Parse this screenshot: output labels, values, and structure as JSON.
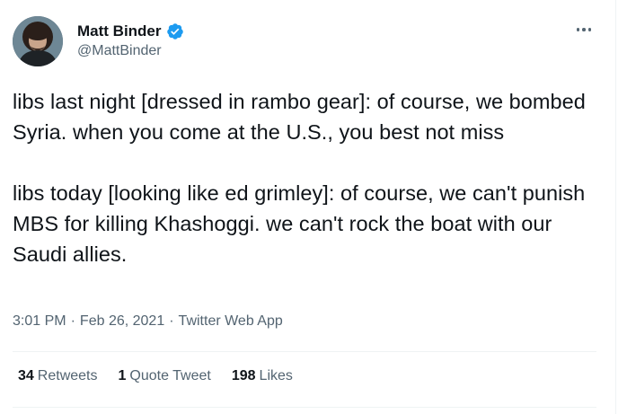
{
  "user": {
    "display_name": "Matt Binder",
    "handle": "@MattBinder",
    "verified_icon": "verified-badge-icon",
    "accent_color": "#1d9bf0"
  },
  "tweet": {
    "text": "libs last night [dressed in rambo gear]: of course, we bombed Syria. when you come at the U.S., you best not miss\n\nlibs today [looking like ed grimley]: of course, we can't punish MBS for killing Khashoggi. we can't rock the boat with our Saudi allies.",
    "time": "3:01 PM",
    "date": "Feb 26, 2021",
    "source": "Twitter Web App",
    "separator": "·"
  },
  "stats": {
    "retweets_count": "34",
    "retweets_label": "Retweets",
    "quotes_count": "1",
    "quotes_label": "Quote Tweet",
    "likes_count": "198",
    "likes_label": "Likes"
  },
  "menu_icon": "more-options-icon"
}
